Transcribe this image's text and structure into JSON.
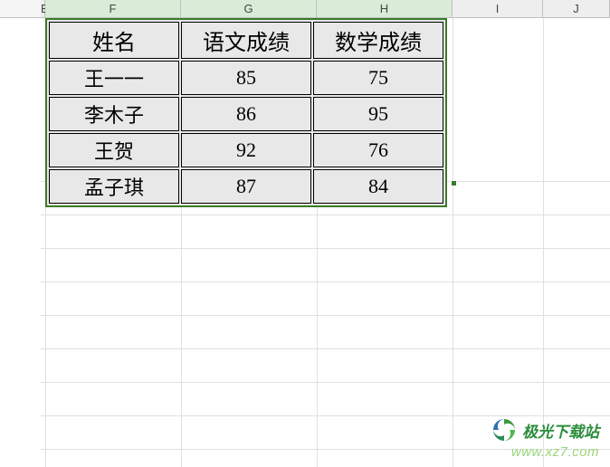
{
  "columns": {
    "E": "E",
    "F": "F",
    "G": "G",
    "H": "H",
    "I": "I",
    "J": "J"
  },
  "table": {
    "headers": {
      "name": "姓名",
      "chinese": "语文成绩",
      "math": "数学成绩"
    },
    "rows": [
      {
        "name": "王一一",
        "chinese": "85",
        "math": "75"
      },
      {
        "name": "李木子",
        "chinese": "86",
        "math": "95"
      },
      {
        "name": "王贺",
        "chinese": "92",
        "math": "76"
      },
      {
        "name": "孟子琪",
        "chinese": "87",
        "math": "84"
      }
    ]
  },
  "watermark": {
    "title": "极光下载站",
    "url": "www.xz7.com"
  },
  "chart_data": {
    "type": "table",
    "title": "",
    "columns": [
      "姓名",
      "语文成绩",
      "数学成绩"
    ],
    "rows": [
      [
        "王一一",
        85,
        75
      ],
      [
        "李木子",
        86,
        95
      ],
      [
        "王贺",
        92,
        76
      ],
      [
        "孟子琪",
        87,
        84
      ]
    ]
  }
}
